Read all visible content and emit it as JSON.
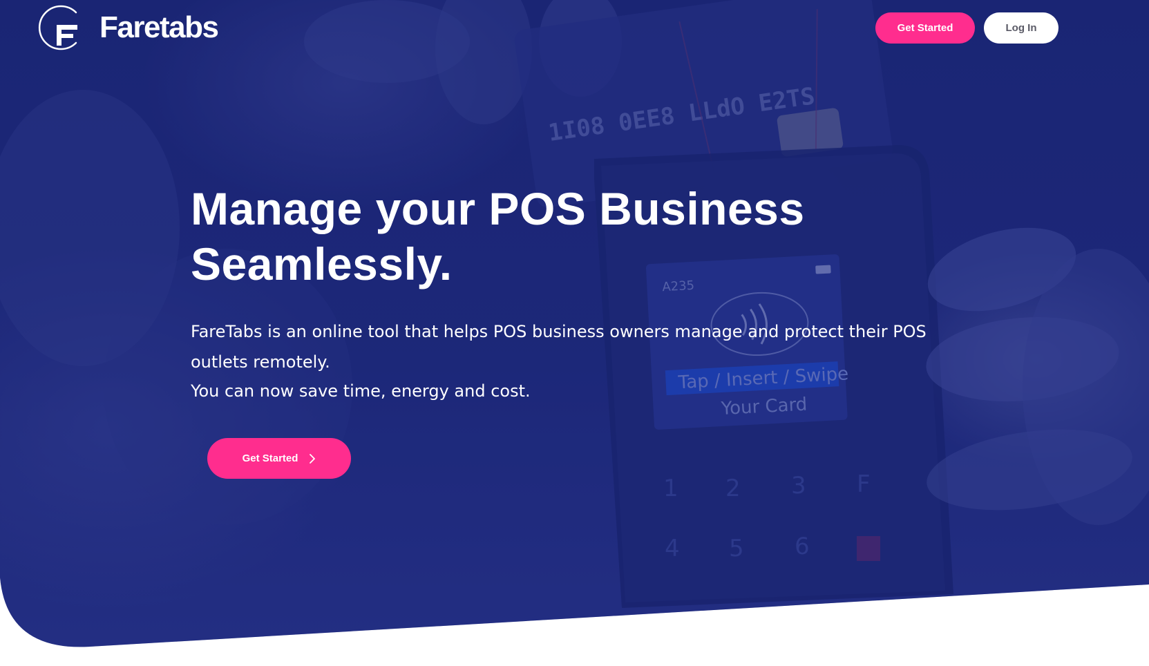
{
  "header": {
    "brand": "Faretabs",
    "get_started_label": "Get Started",
    "login_label": "Log In"
  },
  "hero": {
    "headline_line1": "Manage your POS Business",
    "headline_line2": "Seamlessly.",
    "description": "FareTabs is an online tool that helps POS business owners manage and protect their POS outlets remotely.",
    "description_2": "You can now save time, energy and cost.",
    "cta_label": "Get Started",
    "photo_texts": {
      "card_numbers_1": "1I08 0EE8 LLdO E2TS",
      "terminal_id": "A235",
      "screen_line1": "Tap / Insert / Swipe",
      "screen_line2": "Your Card",
      "keypad": [
        "1",
        "2",
        "3",
        "F",
        "4",
        "5",
        "6"
      ]
    }
  },
  "colors": {
    "hero_bg": "#1d2779",
    "accent": "#ff2d8e",
    "login_bg": "#ffffff",
    "login_text": "#5a5a66"
  }
}
